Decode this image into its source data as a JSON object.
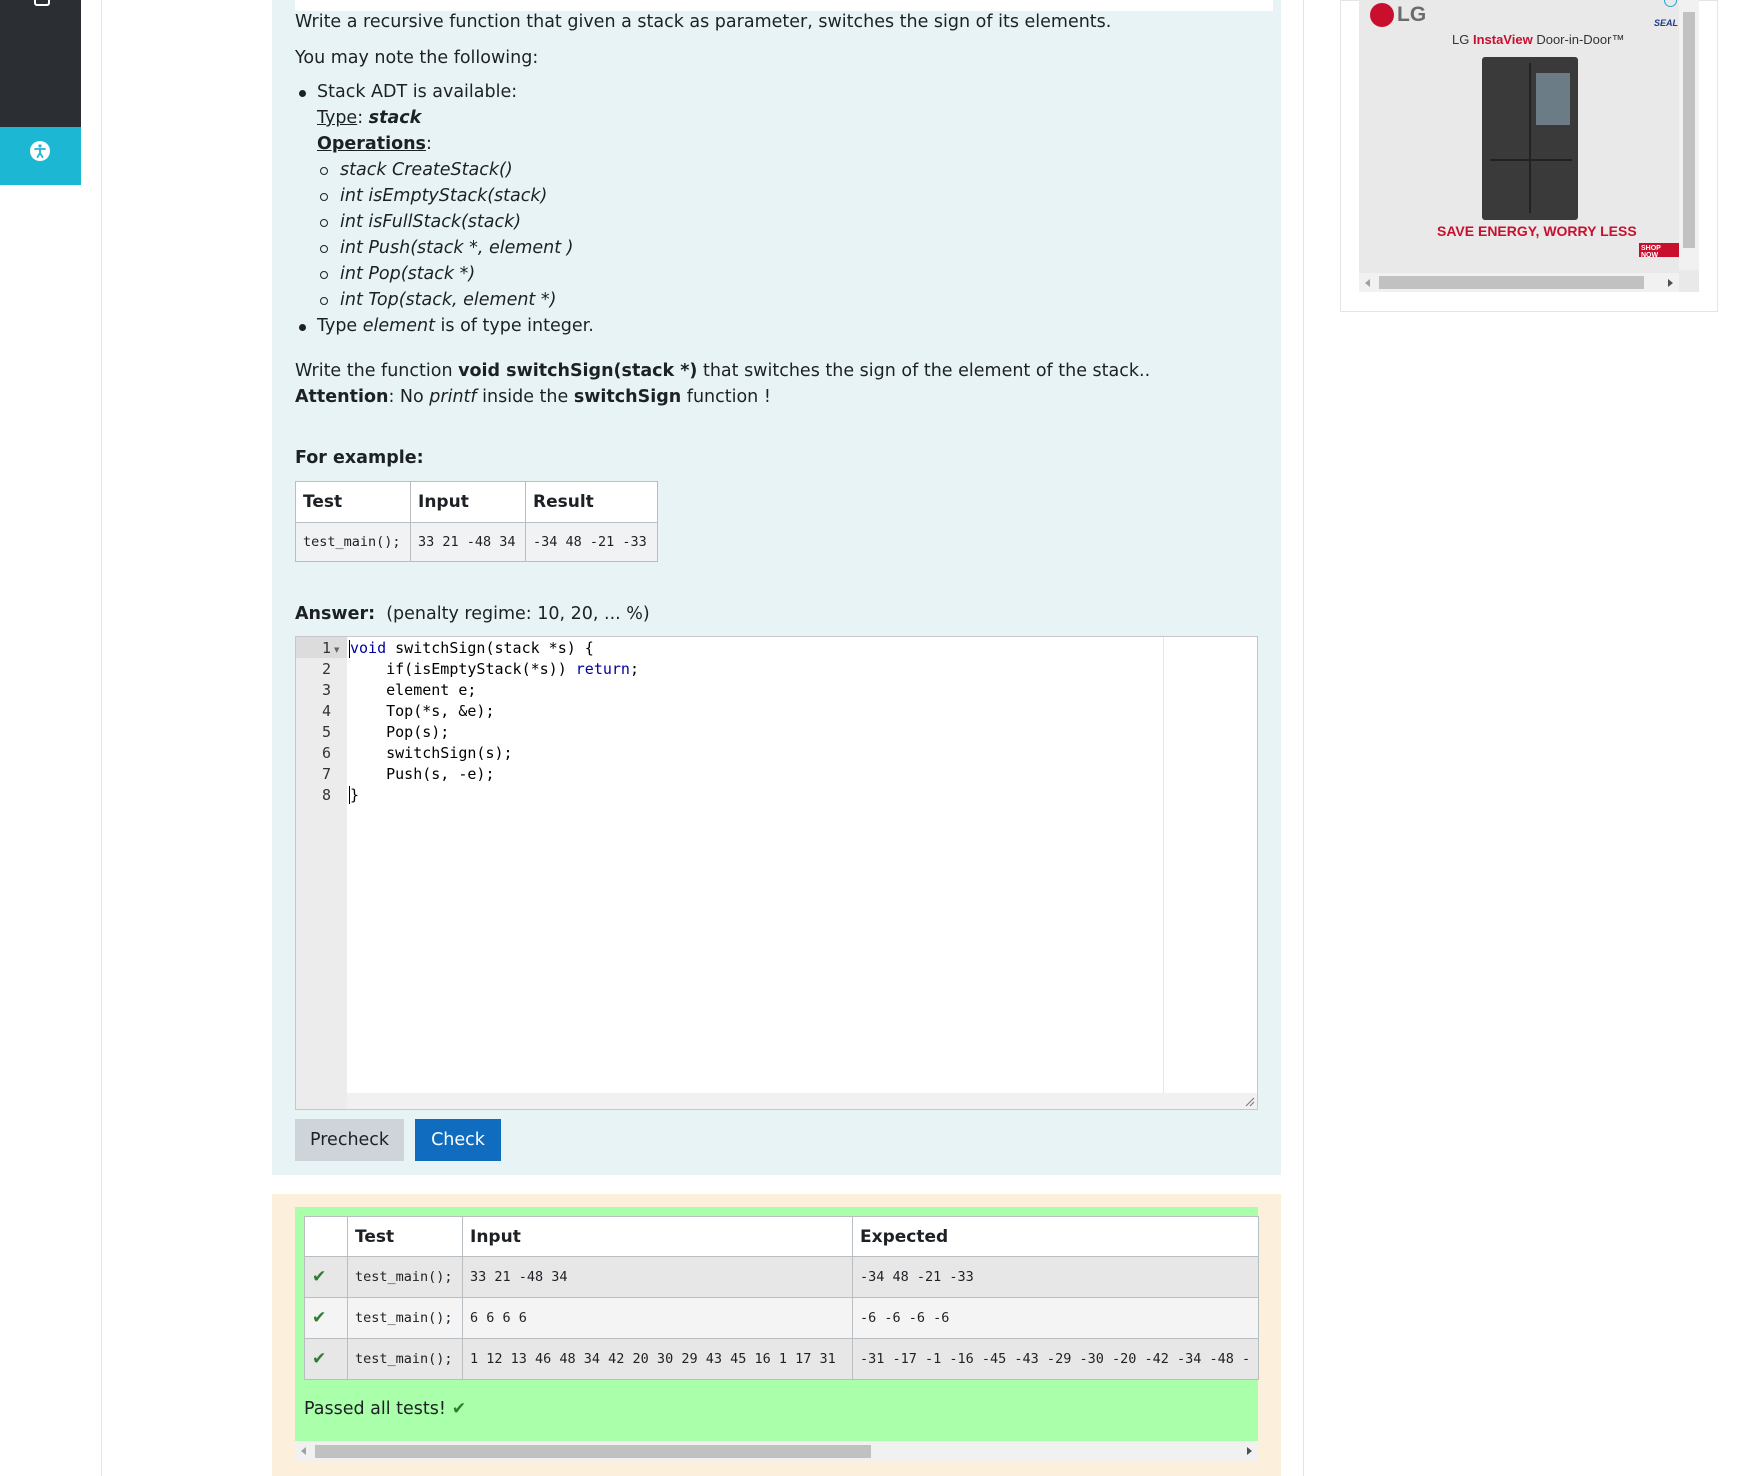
{
  "question": {
    "intro": "Write a recursive function that given a stack as parameter, switches the sign of its elements.",
    "note_lead": "You may note the following:",
    "bullet1": "Stack ADT is available:",
    "type_label": "Type",
    "type_value": "stack",
    "operations_label": "Operations",
    "operations": [
      "stack CreateStack()",
      "int isEmptyStack(stack)",
      "int isFullStack(stack)",
      "int Push(stack *, element )",
      "int Pop(stack *)",
      "int Top(stack, element *)"
    ],
    "bullet2_pre": "Type",
    "bullet2_em": "element",
    "bullet2_post": "is of type integer.",
    "write_pre": "Write the function",
    "write_bold": "void switchSign(stack *)",
    "write_post": "that switches the sign of the element of the stack..",
    "attention_label": "Attention",
    "attention_pre": ": No",
    "attention_em": "printf",
    "attention_mid": "inside the",
    "attention_bold": "switchSign",
    "attention_post": "function !",
    "example_title": "For example:"
  },
  "example_table": {
    "headers": [
      "Test",
      "Input",
      "Result"
    ],
    "row": [
      "test_main();",
      "33 21 -48 34",
      "-34 48 -21 -33"
    ]
  },
  "answer": {
    "label": "Answer:",
    "penalty": "(penalty regime: 10, 20, ... %)"
  },
  "editor": {
    "line_numbers": [
      "1",
      "2",
      "3",
      "4",
      "5",
      "6",
      "7",
      "8"
    ],
    "lines": [
      {
        "kw": "void",
        "rest": " switchSign(stack *s) {"
      },
      {
        "pre": "    if(isEmptyStack(*s)) ",
        "kw": "return",
        "post": ";"
      },
      {
        "text": "    element e;"
      },
      {
        "text": "    Top(*s, &e);"
      },
      {
        "text": "    Pop(s);"
      },
      {
        "text": "    switchSign(s);"
      },
      {
        "text": "    Push(s, -e);"
      },
      {
        "text": "}"
      }
    ]
  },
  "buttons": {
    "precheck": "Precheck",
    "check": "Check"
  },
  "results": {
    "headers": [
      "",
      "Test",
      "Input",
      "Expected"
    ],
    "rows": [
      {
        "test": "test_main();",
        "input": "33 21 -48 34",
        "expected": "-34 48 -21 -33"
      },
      {
        "test": "test_main();",
        "input": "6 6 6 6",
        "expected": "-6 -6 -6 -6"
      },
      {
        "test": "test_main();",
        "input": "1 12 13 46 48 34 42 20 30 29 43 45 16 1 17 31",
        "expected": "-31 -17 -1 -16 -45 -43 -29 -30 -20 -42 -34 -48 -"
      }
    ],
    "tick": "✔",
    "passed": "Passed all tests!"
  },
  "ad": {
    "brand": "LG",
    "subtitle_brand": "LG",
    "subtitle_product": "InstaView",
    "subtitle_rest": "Door-in-Door™",
    "tagline": "SAVE ENERGY, WORRY LESS",
    "cta": "SHOP NOW",
    "seal": "SEAL"
  },
  "colors": {
    "question_bg": "#e7f3f5",
    "result_bg": "#fcefdc",
    "pass_green": "#aaffaa",
    "check_blue": "#0f6cbf",
    "accessibility_cyan": "#1cb8d3"
  }
}
